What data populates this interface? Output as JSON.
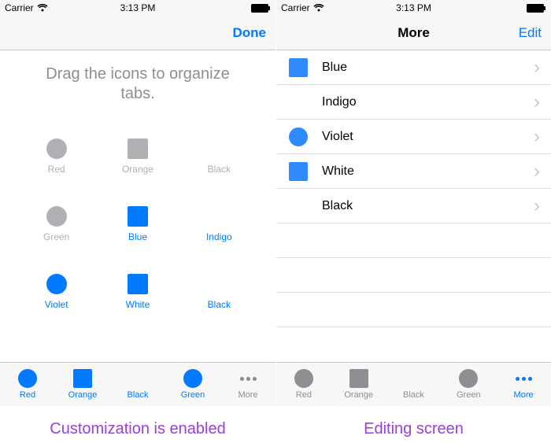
{
  "status": {
    "carrier": "Carrier",
    "time": "3:13 PM"
  },
  "left": {
    "nav": {
      "done": "Done"
    },
    "instruction": "Drag the icons to organize tabs.",
    "grid": [
      {
        "label": "Red",
        "shape": "circle",
        "state": "dim"
      },
      {
        "label": "Orange",
        "shape": "square",
        "state": "dim"
      },
      {
        "label": "Black",
        "shape": "none",
        "state": "dim"
      },
      {
        "label": "Green",
        "shape": "circle",
        "state": "dim"
      },
      {
        "label": "Blue",
        "shape": "square",
        "state": "sel"
      },
      {
        "label": "Indigo",
        "shape": "none",
        "state": "sel"
      },
      {
        "label": "Violet",
        "shape": "circle",
        "state": "sel"
      },
      {
        "label": "White",
        "shape": "square",
        "state": "sel"
      },
      {
        "label": "Black",
        "shape": "none",
        "state": "sel"
      }
    ],
    "tabs": [
      {
        "label": "Red",
        "shape": "circle",
        "mode": "active-blue"
      },
      {
        "label": "Orange",
        "shape": "square",
        "mode": "active-blue"
      },
      {
        "label": "Black",
        "shape": "none",
        "mode": "inactive-blue"
      },
      {
        "label": "Green",
        "shape": "circle",
        "mode": "active-blue"
      },
      {
        "label": "More",
        "shape": "dots",
        "mode": "gray"
      }
    ],
    "caption": "Customization is enabled"
  },
  "right": {
    "nav": {
      "title": "More",
      "edit": "Edit"
    },
    "rows": [
      {
        "label": "Blue",
        "shape": "square"
      },
      {
        "label": "Indigo",
        "shape": "none"
      },
      {
        "label": "Violet",
        "shape": "circle"
      },
      {
        "label": "White",
        "shape": "square"
      },
      {
        "label": "Black",
        "shape": "none"
      }
    ],
    "tabs": [
      {
        "label": "Red",
        "shape": "circle",
        "mode": "gray"
      },
      {
        "label": "Orange",
        "shape": "square",
        "mode": "gray"
      },
      {
        "label": "Black",
        "shape": "none",
        "mode": "gray"
      },
      {
        "label": "Green",
        "shape": "circle",
        "mode": "gray"
      },
      {
        "label": "More",
        "shape": "dots",
        "mode": "active-blue"
      }
    ],
    "caption": "Editing screen"
  }
}
